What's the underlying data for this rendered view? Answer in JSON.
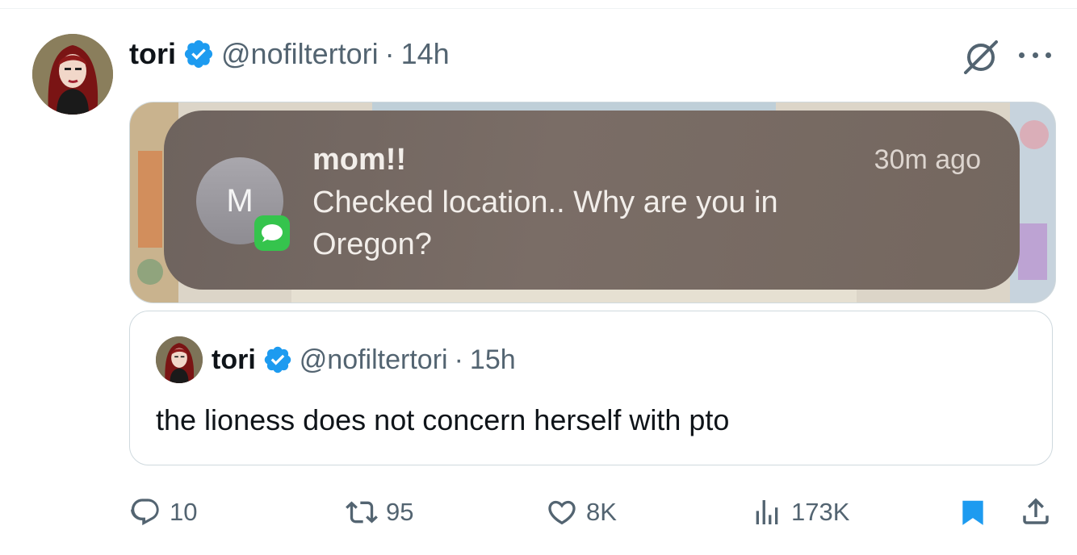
{
  "tweet": {
    "author_name": "tori",
    "author_handle": "@nofiltertori",
    "separator": "·",
    "time": "14h"
  },
  "notification": {
    "avatar_letter": "M",
    "sender": "mom!!",
    "time": "30m ago",
    "message": "Checked location.. Why are you in Oregon?"
  },
  "quoted_tweet": {
    "author_name": "tori",
    "author_handle": "@nofiltertori",
    "separator": "·",
    "time": "15h",
    "text": "the lioness does not concern herself with pto"
  },
  "actions": {
    "replies": "10",
    "reposts": "95",
    "likes": "8K",
    "views": "173K"
  },
  "colors": {
    "verified_blue": "#1d9bf0",
    "secondary_text": "#536471",
    "imessage_green": "#35c44d"
  },
  "icons": [
    "verified-badge-icon",
    "grok-icon",
    "more-icon",
    "reply-icon",
    "repost-icon",
    "like-icon",
    "views-icon",
    "bookmark-icon",
    "share-icon"
  ]
}
